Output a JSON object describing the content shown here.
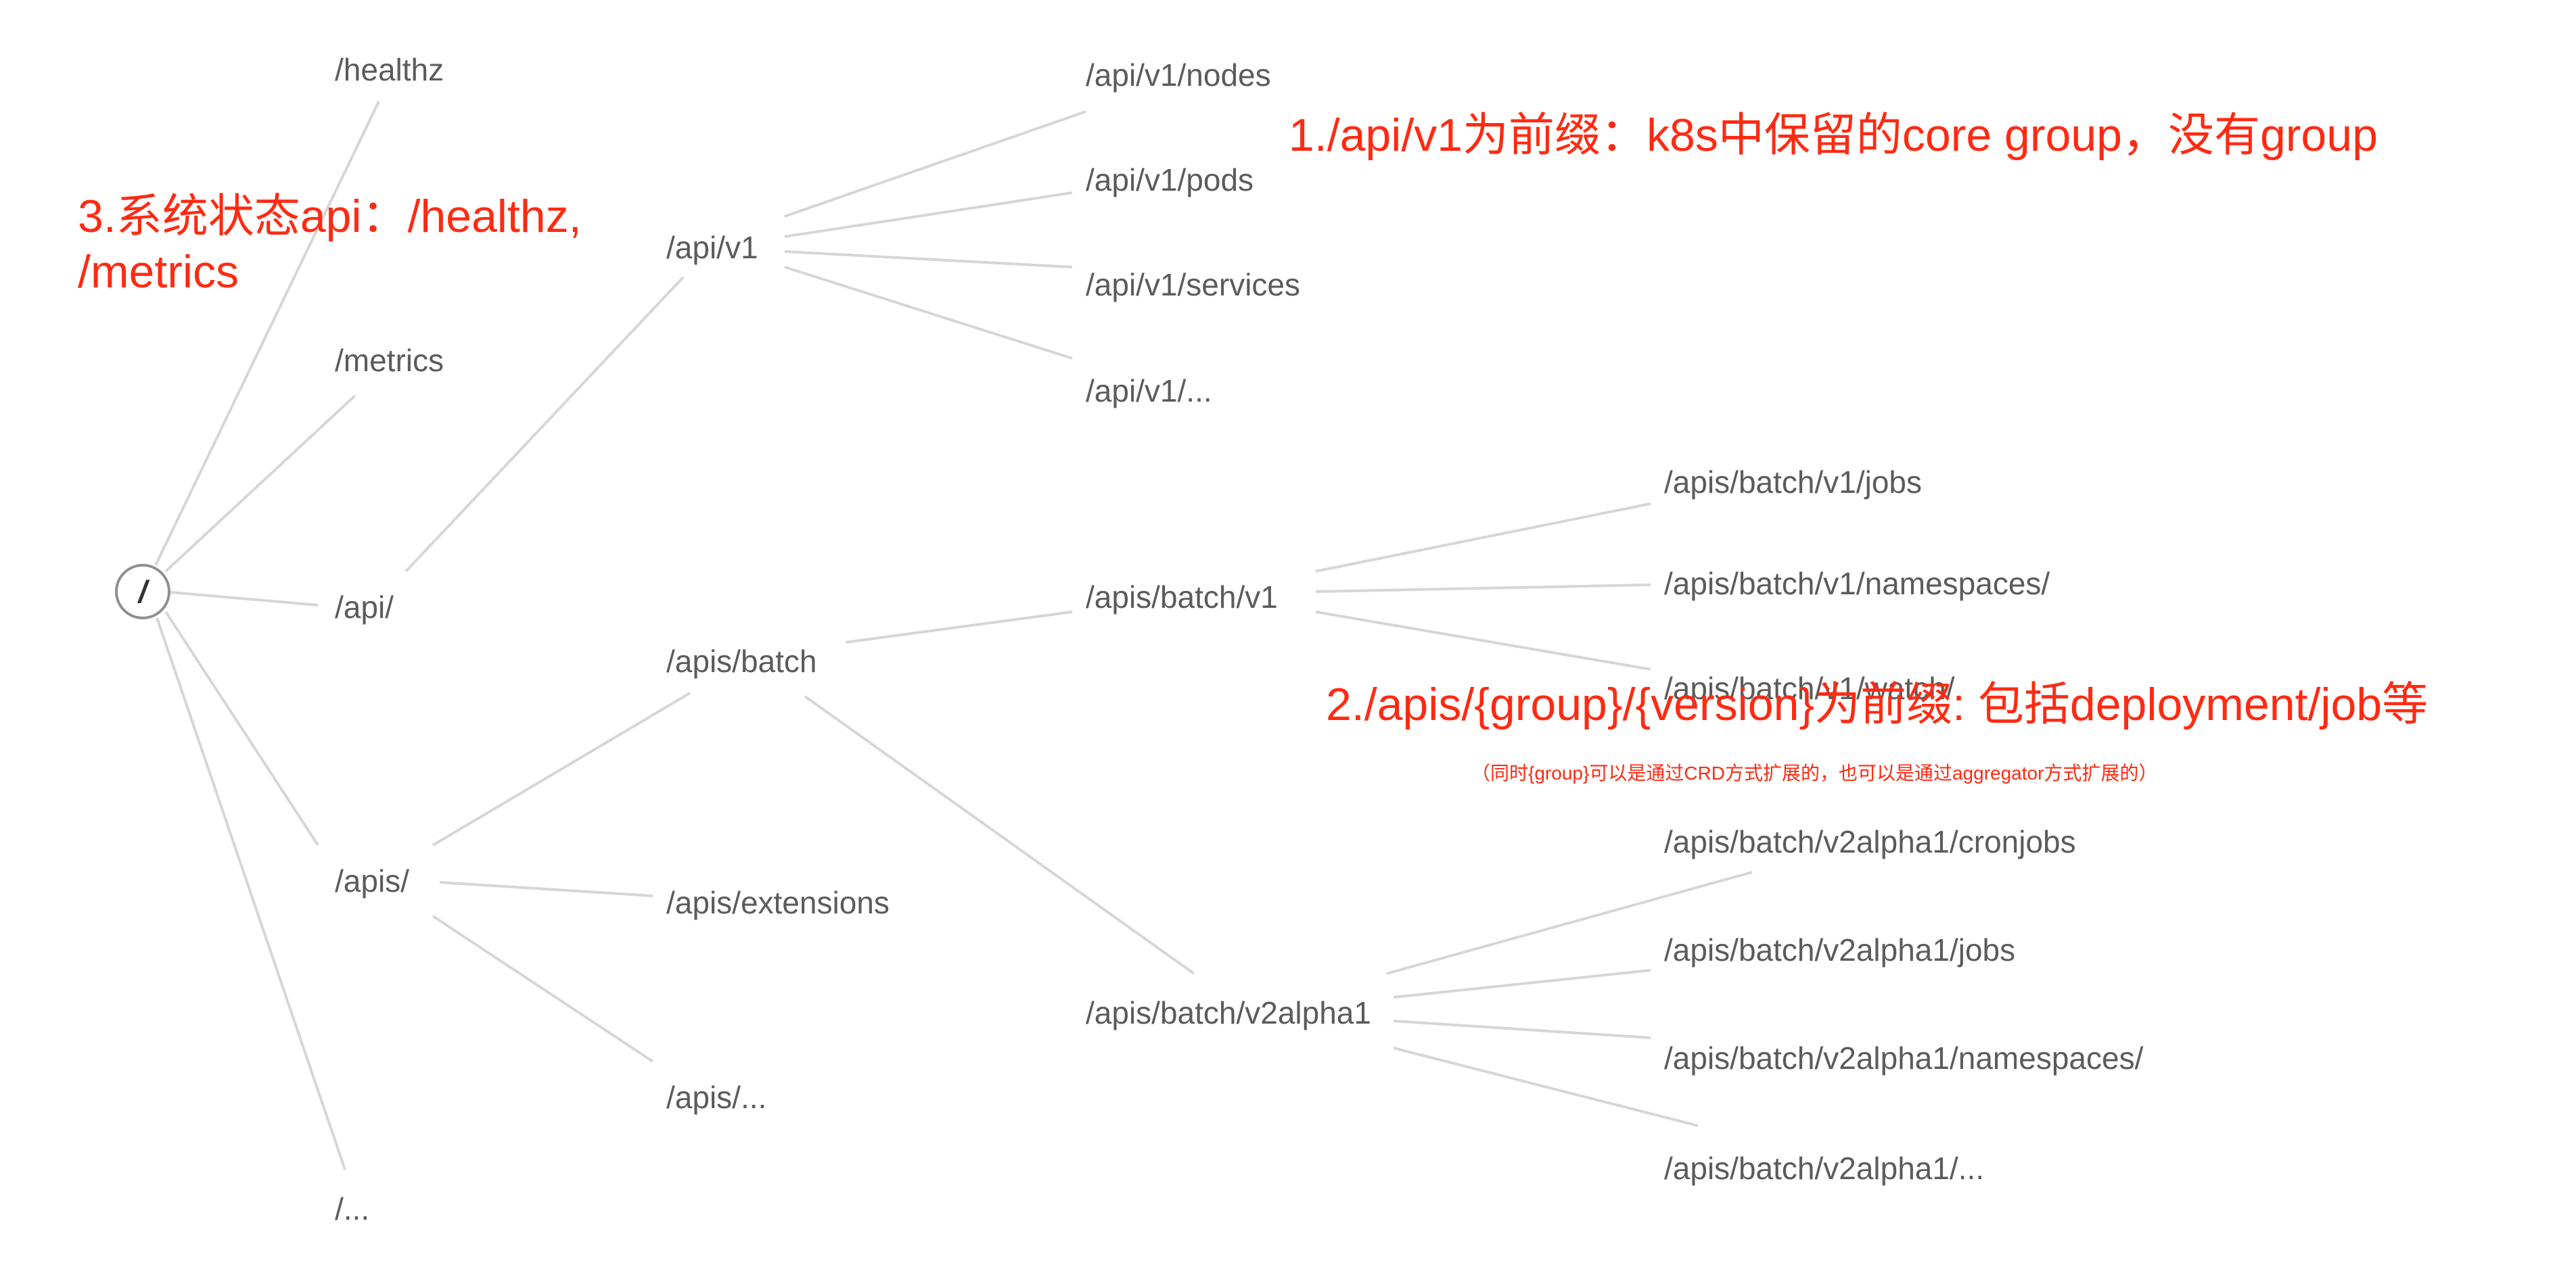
{
  "root": {
    "label": "/"
  },
  "nodes": {
    "healthz": "/healthz",
    "metrics": "/metrics",
    "api": "/api/",
    "apis": "/apis/",
    "root_etc": "/...",
    "api_v1": "/api/v1",
    "apis_batch": "/apis/batch",
    "apis_extensions": "/apis/extensions",
    "apis_etc": "/apis/...",
    "api_v1_nodes": "/api/v1/nodes",
    "api_v1_pods": "/api/v1/pods",
    "api_v1_services": "/api/v1/services",
    "api_v1_etc": "/api/v1/...",
    "apis_batch_v1": "/apis/batch/v1",
    "apis_batch_v2alpha1": "/apis/batch/v2alpha1",
    "apis_batch_v1_jobs": "/apis/batch/v1/jobs",
    "apis_batch_v1_namespaces": "/apis/batch/v1/namespaces/",
    "apis_batch_v1_watch": "/apis/batch/v1/watch/",
    "apis_batch_v2alpha1_cronjobs": "/apis/batch/v2alpha1/cronjobs",
    "apis_batch_v2alpha1_jobs": "/apis/batch/v2alpha1/jobs",
    "apis_batch_v2alpha1_namespaces": "/apis/batch/v2alpha1/namespaces/",
    "apis_batch_v2alpha1_etc": "/apis/batch/v2alpha1/..."
  },
  "annotations": {
    "core_group": "1./api/v1为前缀：k8s中保留的core group，没有group",
    "named_group": "2./apis/{group}/{version}为前缀: 包括deployment/job等",
    "named_group_note": "（同时{group}可以是通过CRD方式扩展的，也可以是通过aggregator方式扩展的）",
    "system_status_line1": "3.系统状态api：/healthz,",
    "system_status_line2": "/metrics"
  },
  "colors": {
    "annotation": "#ff2a12",
    "edge": "#d6d6d6",
    "label": "#5b5b5b"
  }
}
